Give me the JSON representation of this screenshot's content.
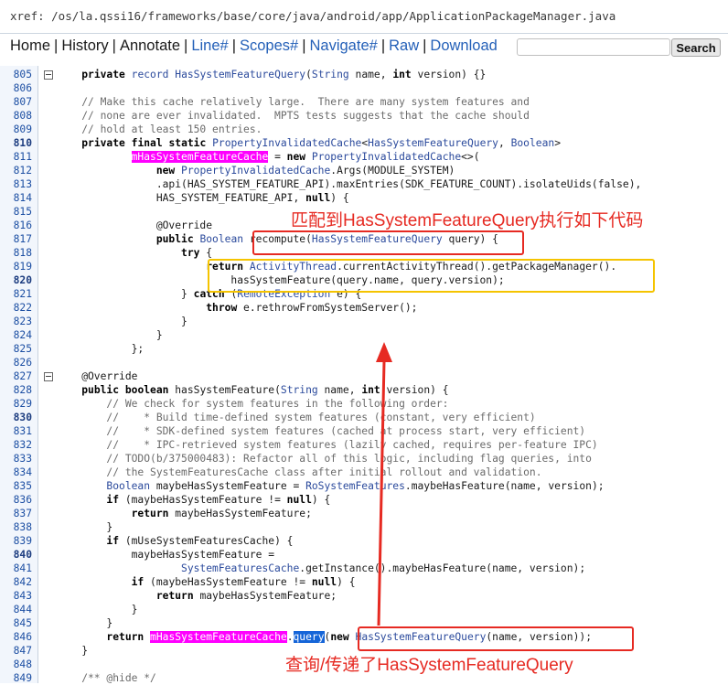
{
  "xref_path": "xref: /os/la.qssi16/frameworks/base/core/java/android/app/ApplicationPackageManager.java",
  "nav": {
    "home": "Home",
    "history": "History",
    "annotate": "Annotate",
    "line": "Line#",
    "scopes": "Scopes#",
    "navigate": "Navigate#",
    "raw": "Raw",
    "download": "Download",
    "search_button": "Search",
    "search_value": ""
  },
  "colors": {
    "magenta_highlight": "#ff00ff",
    "blue_highlight": "#1565d8",
    "red_annotation": "#e62a22",
    "yellow_annotation": "#f5c400"
  },
  "code_lines": [
    {
      "num": "805",
      "fold": true,
      "text": "    private record HasSystemFeatureQuery(String name, int version) {}"
    },
    {
      "num": "806",
      "text": ""
    },
    {
      "num": "807",
      "text": "    // Make this cache relatively large.  There are many system features and"
    },
    {
      "num": "808",
      "text": "    // none are ever invalidated.  MPTS tests suggests that the cache should"
    },
    {
      "num": "809",
      "text": "    // hold at least 150 entries."
    },
    {
      "num": "810",
      "bold": true,
      "text": "    private final static PropertyInvalidatedCache<HasSystemFeatureQuery, Boolean>"
    },
    {
      "num": "811",
      "text": "            mHasSystemFeatureCache = new PropertyInvalidatedCache<>("
    },
    {
      "num": "812",
      "text": "                new PropertyInvalidatedCache.Args(MODULE_SYSTEM)"
    },
    {
      "num": "813",
      "text": "                .api(HAS_SYSTEM_FEATURE_API).maxEntries(SDK_FEATURE_COUNT).isolateUids(false),"
    },
    {
      "num": "814",
      "text": "                HAS_SYSTEM_FEATURE_API, null) {"
    },
    {
      "num": "815",
      "text": ""
    },
    {
      "num": "816",
      "text": "                @Override"
    },
    {
      "num": "817",
      "text": "                public Boolean recompute(HasSystemFeatureQuery query) {"
    },
    {
      "num": "818",
      "text": "                    try {"
    },
    {
      "num": "819",
      "text": "                        return ActivityThread.currentActivityThread().getPackageManager()."
    },
    {
      "num": "820",
      "bold": true,
      "text": "                            hasSystemFeature(query.name, query.version);"
    },
    {
      "num": "821",
      "text": "                    } catch (RemoteException e) {"
    },
    {
      "num": "822",
      "text": "                        throw e.rethrowFromSystemServer();"
    },
    {
      "num": "823",
      "text": "                    }"
    },
    {
      "num": "824",
      "text": "                }"
    },
    {
      "num": "825",
      "text": "            };"
    },
    {
      "num": "826",
      "text": ""
    },
    {
      "num": "827",
      "fold": true,
      "text": "    @Override"
    },
    {
      "num": "828",
      "text": "    public boolean hasSystemFeature(String name, int version) {"
    },
    {
      "num": "829",
      "text": "        // We check for system features in the following order:"
    },
    {
      "num": "830",
      "bold": true,
      "text": "        //    * Build time-defined system features (constant, very efficient)"
    },
    {
      "num": "831",
      "text": "        //    * SDK-defined system features (cached at process start, very efficient)"
    },
    {
      "num": "832",
      "text": "        //    * IPC-retrieved system features (lazily cached, requires per-feature IPC)"
    },
    {
      "num": "833",
      "text": "        // TODO(b/375000483): Refactor all of this logic, including flag queries, into"
    },
    {
      "num": "834",
      "text": "        // the SystemFeaturesCache class after initial rollout and validation."
    },
    {
      "num": "835",
      "text": "        Boolean maybeHasSystemFeature = RoSystemFeatures.maybeHasFeature(name, version);"
    },
    {
      "num": "836",
      "text": "        if (maybeHasSystemFeature != null) {"
    },
    {
      "num": "837",
      "text": "            return maybeHasSystemFeature;"
    },
    {
      "num": "838",
      "text": "        }"
    },
    {
      "num": "839",
      "text": "        if (mUseSystemFeaturesCache) {"
    },
    {
      "num": "840",
      "bold": true,
      "text": "            maybeHasSystemFeature ="
    },
    {
      "num": "841",
      "text": "                    SystemFeaturesCache.getInstance().maybeHasFeature(name, version);"
    },
    {
      "num": "842",
      "text": "            if (maybeHasSystemFeature != null) {"
    },
    {
      "num": "843",
      "text": "                return maybeHasSystemFeature;"
    },
    {
      "num": "844",
      "text": "            }"
    },
    {
      "num": "845",
      "text": "        }"
    },
    {
      "num": "846",
      "text": "        return mHasSystemFeatureCache.query(new HasSystemFeatureQuery(name, version));"
    },
    {
      "num": "847",
      "text": "    }"
    },
    {
      "num": "848",
      "text": ""
    },
    {
      "num": "849",
      "text": "    /** @hide */"
    }
  ],
  "annotations": {
    "match_note": "匹配到HasSystemFeatureQuery执行如下代码",
    "query_note": "查询/传递了HasSystemFeatureQuery"
  }
}
